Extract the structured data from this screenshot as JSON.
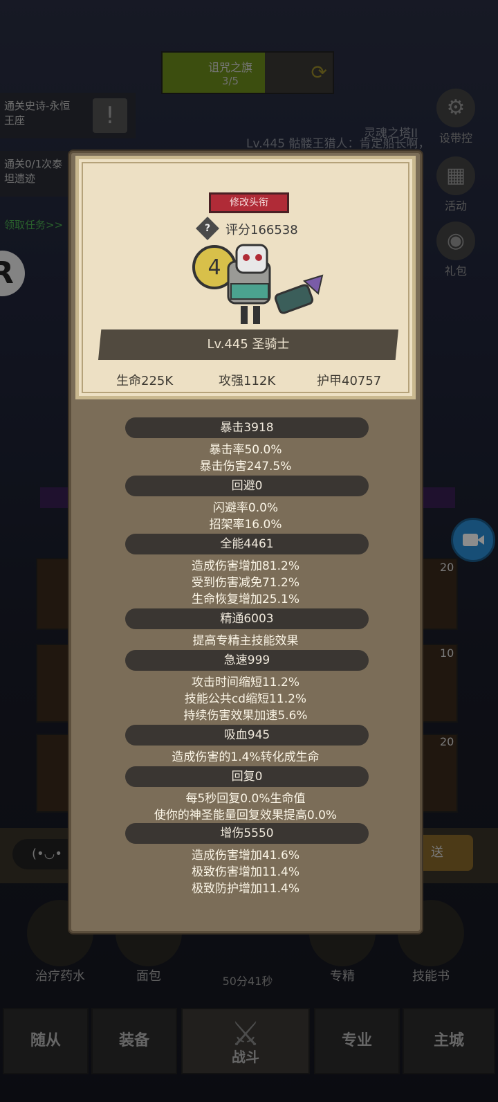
{
  "background": {
    "quest_title": "诅咒之旗",
    "quest_progress": "3/5",
    "side_task_1": [
      "通关史诗-永恒",
      "王座"
    ],
    "side_task_2": [
      "通关0/1次泰",
      "坦遗迹"
    ],
    "get_task": "领取任务>>",
    "top_text": "Lv.445 骷髅王猎人：肯定船长啊，",
    "tower_text": "灵魂之塔II",
    "settings_label": "设带控",
    "activity_label": "活动",
    "gift_label": "礼包",
    "tile_nums": [
      "20",
      "10",
      "20"
    ],
    "chat_face": "(•◡•",
    "send_label": "送",
    "items": [
      "治疗药水",
      "面包",
      "专精",
      "技能书"
    ],
    "timer": "50分41秒",
    "tabs": {
      "follower": "随从",
      "equip": "装备",
      "battle": "战斗",
      "profession": "专业",
      "city": "主城"
    }
  },
  "modal": {
    "edit_title_button": "修改头衔",
    "score_help": "?",
    "score": "评分166538",
    "hero_name": "Lv.445 圣骑士",
    "stats": {
      "hp": "生命225K",
      "atk": "攻强112K",
      "armor": "护甲40757"
    },
    "sections": [
      {
        "header": "暴击3918",
        "lines": [
          "暴击率50.0%",
          "暴击伤害247.5%"
        ]
      },
      {
        "header": "回避0",
        "lines": [
          "闪避率0.0%",
          "招架率16.0%"
        ]
      },
      {
        "header": "全能4461",
        "lines": [
          "造成伤害增加81.2%",
          "受到伤害减免71.2%",
          "生命恢复增加25.1%"
        ]
      },
      {
        "header": "精通6003",
        "lines": [
          "提高专精主技能效果"
        ]
      },
      {
        "header": "急速999",
        "lines": [
          "攻击时间缩短11.2%",
          "技能公共cd缩短11.2%",
          "持续伤害效果加速5.6%"
        ]
      },
      {
        "header": "吸血945",
        "lines": [
          "造成伤害的1.4%转化成生命"
        ]
      },
      {
        "header": "回复0",
        "lines": [
          "每5秒回复0.0%生命值",
          "使你的神圣能量回复效果提高0.0%"
        ]
      },
      {
        "header": "增伤5550",
        "lines": [
          "造成伤害增加41.6%",
          "极致伤害增加11.4%",
          "极致防护增加11.4%"
        ]
      }
    ]
  },
  "colors": {
    "modal_bg": "#7b6d58",
    "card_bg": "#ede0c4",
    "edit_button": "#b02b37",
    "header_pill": "#3a3632"
  }
}
